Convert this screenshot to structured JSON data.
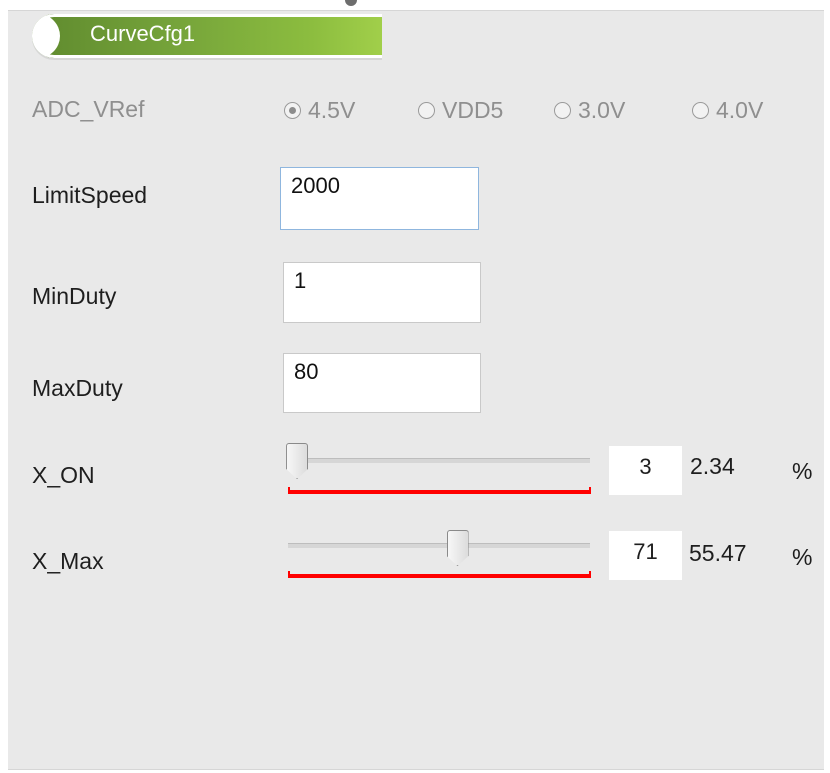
{
  "tab": {
    "label": "CurveCfg1"
  },
  "adc": {
    "label": "ADC_VRef",
    "options": [
      "4.5V",
      "VDD5",
      "3.0V",
      "4.0V"
    ],
    "selected": "4.5V"
  },
  "fields": {
    "limit_speed": {
      "label": "LimitSpeed",
      "value": "2000"
    },
    "min_duty": {
      "label": "MinDuty",
      "value": "1"
    },
    "max_duty": {
      "label": "MaxDuty",
      "value": "80"
    }
  },
  "sliders": {
    "x_on": {
      "label": "X_ON",
      "value": "3",
      "percent": "2.34",
      "unit": "%",
      "fraction": 0.0234
    },
    "x_max": {
      "label": "X_Max",
      "value": "71",
      "percent": "55.47",
      "unit": "%",
      "fraction": 0.5547
    }
  },
  "colors": {
    "tab_green": "#75a33a",
    "range_red": "#ff0000",
    "panel_bg": "#e9e9e9"
  }
}
